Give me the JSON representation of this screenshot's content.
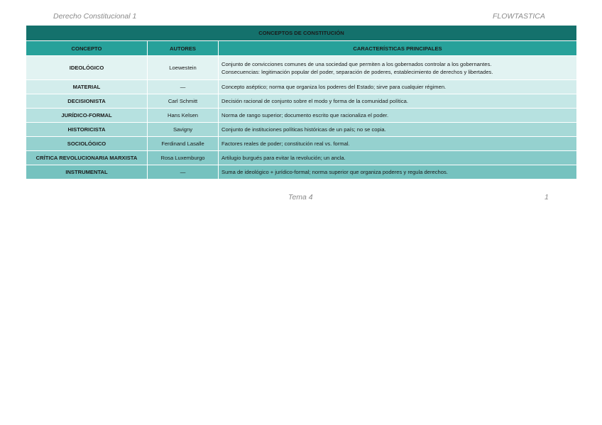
{
  "header": {
    "left": "Derecho Constitucional 1",
    "right": "FLOWTASTICA"
  },
  "footer": {
    "center": "Tema 4",
    "page": "1"
  },
  "table": {
    "title": "CONCEPTOS DE CONSTITUCIÓN",
    "columns": [
      "CONCEPTO",
      "AUTORES",
      "CARACTERÍSTICAS PRINCIPALES"
    ],
    "rows": [
      {
        "concept": "IDEOLÓGICO",
        "author": "Loewestein",
        "desc": "Conjunto de convicciones comunes de una sociedad que permiten a los gobernados controlar a los gobernantes.",
        "desc2": "Consecuencias: legitimación popular del poder, separación de poderes, establecimiento de derechos y libertades."
      },
      {
        "concept": "MATERIAL",
        "author": "—",
        "desc": "Concepto aséptico; norma que organiza los poderes del Estado; sirve para cualquier régimen."
      },
      {
        "concept": "DECISIONISTA",
        "author": "Carl Schmitt",
        "desc": "Decisión racional de conjunto sobre el modo y forma de la comunidad política."
      },
      {
        "concept": "JURÍDICO-FORMAL",
        "author": "Hans Kelsen",
        "desc": "Norma de rango superior; documento escrito que racionaliza el poder."
      },
      {
        "concept": "HISTORICISTA",
        "author": "Savigny",
        "desc": "Conjunto de instituciones políticas históricas de un país; no se copia."
      },
      {
        "concept": "SOCIOLÓGICO",
        "author": "Ferdinand Lasalle",
        "desc": "Factores reales de poder; constitución real vs. formal."
      },
      {
        "concept": "CRÍTICA REVOLUCIONARIA MARXISTA",
        "author": "Rosa Luxemburgo",
        "desc": "Artilugio burgués para evitar la revolución; un ancla."
      },
      {
        "concept": "INSTRUMENTAL",
        "author": "—",
        "desc": "Suma de ideológico + jurídico-formal; norma superior que organiza poderes y regula derechos."
      }
    ]
  },
  "colors": {
    "title_bg": "#14716c",
    "header_bg": "#27a19a",
    "row_gradient": [
      "#e2f3f2",
      "#d3edec",
      "#c4e7e6",
      "#b6e1e0",
      "#a6d9d7",
      "#95d1cf",
      "#86cac8",
      "#75c2bf"
    ]
  }
}
